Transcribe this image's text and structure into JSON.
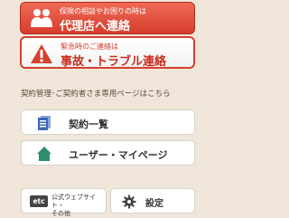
{
  "agency_contact": {
    "subtitle": "保険の相談やお困りの時は",
    "title": "代理店へ連絡",
    "icon": "people-icon"
  },
  "emergency_contact": {
    "subtitle": "緊急時のご連絡は",
    "title": "事故・トラブル連絡",
    "icon": "warning-icon"
  },
  "section_heading": "契約管理･ご契約者さま専用ページはこちら",
  "menu": {
    "contract_list": "契約一覧",
    "user_mypage": "ユーザー・マイページ"
  },
  "bottom": {
    "etc_badge": "etc",
    "official_site_line1": "公式ウェブサイト・",
    "official_site_line2": "その他",
    "settings": "設定"
  },
  "colors": {
    "accent_red": "#d73f2f",
    "house_green": "#2d8f6a",
    "document_blue": "#3b67b5",
    "background": "#efe6d9"
  }
}
